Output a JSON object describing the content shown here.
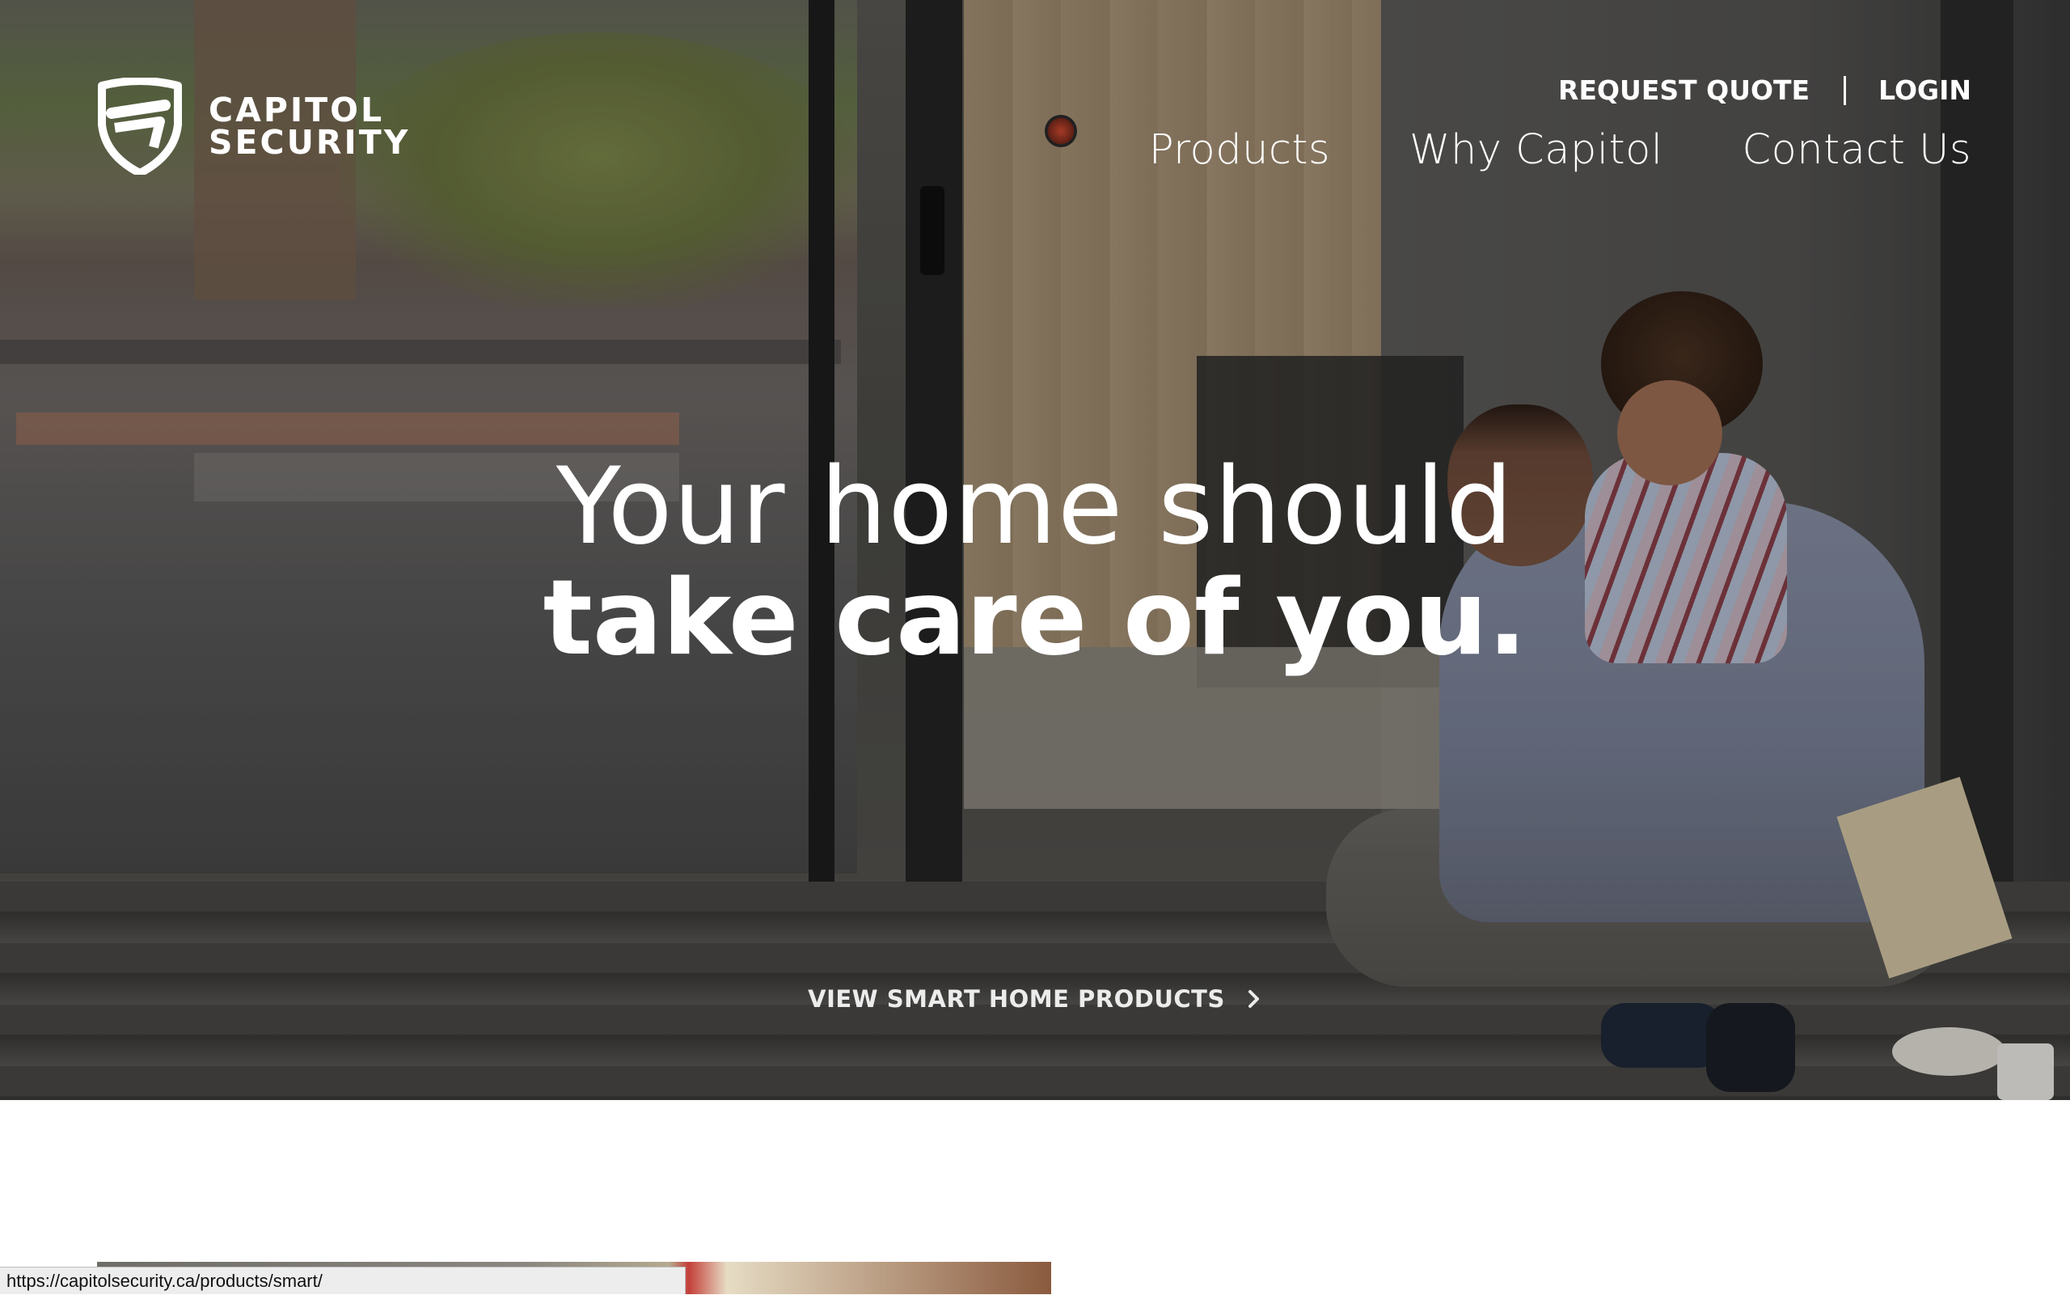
{
  "brand": {
    "line1": "CAPITOL",
    "line2": "SECURITY"
  },
  "utility_nav": {
    "request_quote": "REQUEST QUOTE",
    "login": "LOGIN"
  },
  "main_nav": {
    "products": "Products",
    "why_capitol": "Why Capitol",
    "contact_us": "Contact Us"
  },
  "hero": {
    "headline_line1": "Your home should",
    "headline_line2": "take care of you.",
    "cta_label": "VIEW SMART HOME PRODUCTS",
    "cta_icon": "chevron-right-icon"
  },
  "status_bar": {
    "url": "https://capitolsecurity.ca/products/smart/"
  },
  "colors": {
    "text": "#ffffff",
    "page_background": "#ffffff"
  }
}
